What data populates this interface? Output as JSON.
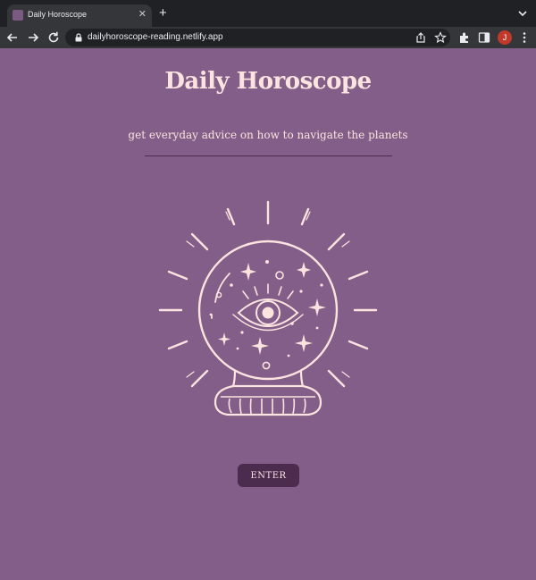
{
  "browser": {
    "tab_title": "Daily Horoscope",
    "url": "dailyhoroscope-reading.netlify.app",
    "profile_initial": "J"
  },
  "page": {
    "title": "Daily Horoscope",
    "subtitle": "get everyday advice on how to navigate the planets",
    "enter_label": "ENTER"
  },
  "colors": {
    "background": "#825e88",
    "text": "#fbe4e0",
    "accent": "#4b2c4f"
  },
  "icons": [
    "tab-favicon",
    "close-icon",
    "plus-icon",
    "chevron-down-icon",
    "back-arrow-icon",
    "forward-arrow-icon",
    "reload-icon",
    "lock-icon",
    "share-icon",
    "star-icon",
    "extensions-icon",
    "sidepanel-icon",
    "kebab-menu-icon",
    "crystal-ball-icon"
  ]
}
